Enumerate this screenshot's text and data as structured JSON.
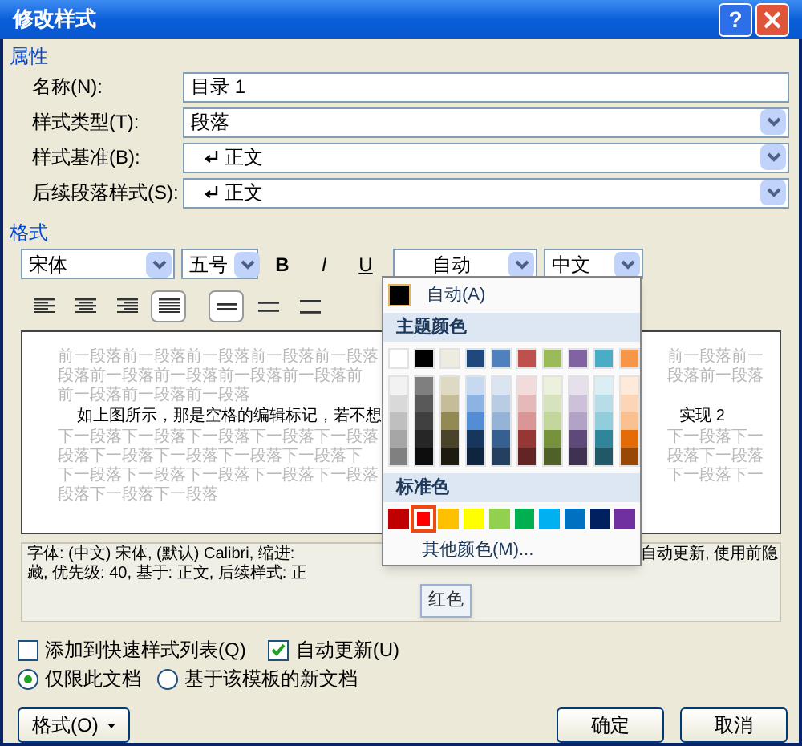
{
  "window": {
    "title": "修改样式",
    "help": "?"
  },
  "properties": {
    "heading": "属性",
    "rows": [
      {
        "label": "名称(N):",
        "value": "目录 1",
        "kind": "text"
      },
      {
        "label": "样式类型(T):",
        "value": "段落",
        "kind": "select"
      },
      {
        "label": "样式基准(B):",
        "value": "正文",
        "kind": "style"
      },
      {
        "label": "后续段落样式(S):",
        "value": "正文",
        "kind": "style"
      }
    ]
  },
  "format": {
    "heading": "格式",
    "font": "宋体",
    "size": "五号",
    "style_buttons": [
      {
        "kind": "bold",
        "label": "B",
        "selected": false
      },
      {
        "kind": "italic",
        "label": "I",
        "selected": false
      },
      {
        "kind": "underline",
        "label": "U",
        "selected": false
      }
    ],
    "color_label": "自动",
    "language": "中文",
    "align_buttons": [
      {
        "kind": "left",
        "selected": false
      },
      {
        "kind": "center",
        "selected": false
      },
      {
        "kind": "right",
        "selected": false
      },
      {
        "kind": "justify",
        "selected": true
      },
      {
        "kind": "single",
        "selected": true
      },
      {
        "kind": "onehalf",
        "selected": false
      },
      {
        "kind": "double",
        "selected": false
      }
    ]
  },
  "preview": {
    "lines": [
      {
        "kind": "context",
        "left": "前一段落前一段落前一段落前一段落前一段落",
        "right": "前一段落前一"
      },
      {
        "kind": "context",
        "left": "段落前一段落前一段落前一段落前一段落前",
        "right": "段落前一段落"
      },
      {
        "kind": "context",
        "left": "前一段落前一段落前一段落"
      },
      {
        "kind": "sample",
        "left": "如上图所示，那是空格的编辑标记，若不想",
        "right": "实现 2"
      },
      {
        "kind": "context",
        "left": "下一段落下一段落下一段落下一段落下一段落",
        "right": "下一段落下一"
      },
      {
        "kind": "context",
        "left": "段落下一段落下一段落下一段落下一段落下",
        "right": "段落下一段落"
      },
      {
        "kind": "context",
        "left": "下一段落下一段落下一段落下一段落下一段落",
        "right": "下一段落下一"
      },
      {
        "kind": "context",
        "left": "段落下一段落下一段落"
      }
    ]
  },
  "description": {
    "lines": [
      {
        "left": "字体: (中文) 宋体, (默认) Calibri, 缩进:",
        "right": "自动更新, 使用前隐"
      },
      {
        "left": "藏, 优先级: 40, 基于: 正文, 后续样式: 正"
      }
    ]
  },
  "options": {
    "checkboxes": [
      {
        "label": "添加到快速样式列表(Q)",
        "checked": false
      },
      {
        "label": "自动更新(U)",
        "checked": true
      }
    ],
    "radios": [
      {
        "label": "仅限此文档",
        "selected": true
      },
      {
        "label": "基于该模板的新文档",
        "selected": false
      }
    ]
  },
  "buttons": {
    "format": "格式(O)",
    "ok": "确定",
    "cancel": "取消"
  },
  "color_menu": {
    "auto": "自动(A)",
    "auto_swatch": {
      "color": "#000000"
    },
    "theme_heading": "主题颜色",
    "theme": [
      {
        "color": "#ffffff",
        "shades": [
          {
            "color": "#f2f2f2"
          },
          {
            "color": "#d9d9d9"
          },
          {
            "color": "#bfbfbf"
          },
          {
            "color": "#a6a6a6"
          },
          {
            "color": "#808080"
          }
        ]
      },
      {
        "color": "#000000",
        "shades": [
          {
            "color": "#7f7f7f"
          },
          {
            "color": "#595959"
          },
          {
            "color": "#404040"
          },
          {
            "color": "#262626"
          },
          {
            "color": "#0d0d0d"
          }
        ]
      },
      {
        "color": "#eeece1",
        "shades": [
          {
            "color": "#ddd9c3"
          },
          {
            "color": "#c4bd97"
          },
          {
            "color": "#938953"
          },
          {
            "color": "#494429"
          },
          {
            "color": "#1d1b10"
          }
        ]
      },
      {
        "color": "#1f497d",
        "shades": [
          {
            "color": "#c6d9f0"
          },
          {
            "color": "#8db3e2"
          },
          {
            "color": "#548dd4"
          },
          {
            "color": "#17365d"
          },
          {
            "color": "#0f243e"
          }
        ]
      },
      {
        "color": "#4f81bd",
        "shades": [
          {
            "color": "#dbe5f1"
          },
          {
            "color": "#b8cce4"
          },
          {
            "color": "#95b3d7"
          },
          {
            "color": "#366092"
          },
          {
            "color": "#244061"
          }
        ]
      },
      {
        "color": "#c0504d",
        "shades": [
          {
            "color": "#f2dcdb"
          },
          {
            "color": "#e5b9b7"
          },
          {
            "color": "#d99694"
          },
          {
            "color": "#953734"
          },
          {
            "color": "#632423"
          }
        ]
      },
      {
        "color": "#9bbb59",
        "shades": [
          {
            "color": "#ebf1dd"
          },
          {
            "color": "#d7e3bc"
          },
          {
            "color": "#c3d69b"
          },
          {
            "color": "#76923c"
          },
          {
            "color": "#4f6128"
          }
        ]
      },
      {
        "color": "#8064a2",
        "shades": [
          {
            "color": "#e5e0ec"
          },
          {
            "color": "#ccc1d9"
          },
          {
            "color": "#b2a2c7"
          },
          {
            "color": "#5f497a"
          },
          {
            "color": "#3f3151"
          }
        ]
      },
      {
        "color": "#4bacc6",
        "shades": [
          {
            "color": "#dbeef3"
          },
          {
            "color": "#b7dde8"
          },
          {
            "color": "#92cddc"
          },
          {
            "color": "#31859b"
          },
          {
            "color": "#205867"
          }
        ]
      },
      {
        "color": "#f79646",
        "shades": [
          {
            "color": "#fdeada"
          },
          {
            "color": "#fbd5b5"
          },
          {
            "color": "#fac08f"
          },
          {
            "color": "#e36c09"
          },
          {
            "color": "#974806"
          }
        ]
      }
    ],
    "standard_heading": "标准色",
    "standard": [
      {
        "color": "#c00000",
        "selected": false
      },
      {
        "color": "#ff0000",
        "selected": true
      },
      {
        "color": "#ffc000",
        "selected": false
      },
      {
        "color": "#ffff00",
        "selected": false
      },
      {
        "color": "#92d050",
        "selected": false
      },
      {
        "color": "#00b050",
        "selected": false
      },
      {
        "color": "#00b0f0",
        "selected": false
      },
      {
        "color": "#0070c0",
        "selected": false
      },
      {
        "color": "#002060",
        "selected": false
      },
      {
        "color": "#7030a0",
        "selected": false
      }
    ],
    "more": "其他颜色(M)...",
    "tooltip": "红色"
  }
}
